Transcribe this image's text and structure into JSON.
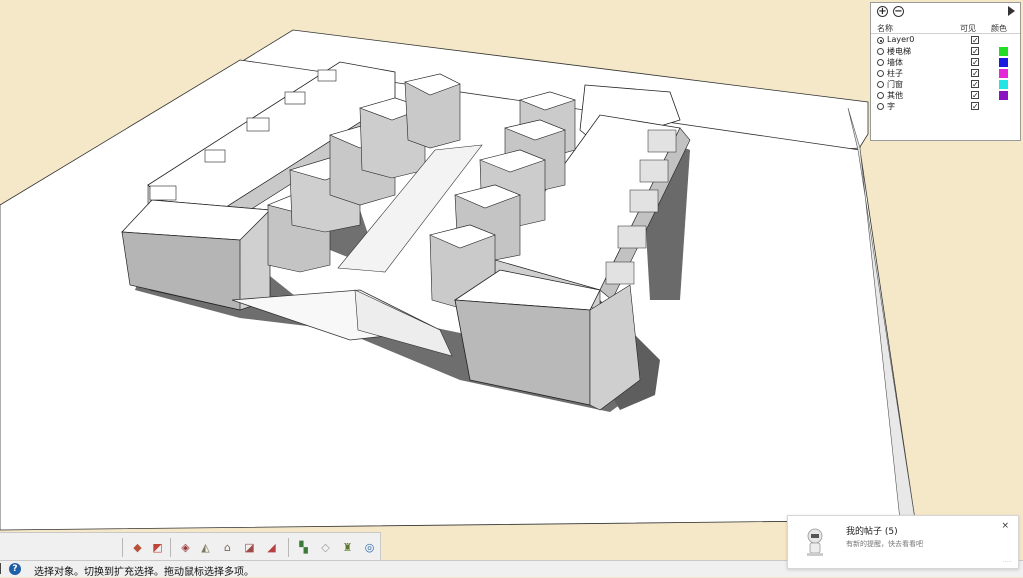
{
  "layers_panel": {
    "add_icon": "plus-circle-icon",
    "remove_icon": "minus-circle-icon",
    "details_icon": "details-arrow-icon",
    "col_name": "名称",
    "col_visible": "可见",
    "col_color": "颜色",
    "visible_mark": "✓",
    "layers": [
      {
        "name": "Layer0",
        "active": true,
        "visible": true,
        "color": ""
      },
      {
        "name": "楼电梯",
        "active": false,
        "visible": true,
        "color": "#22dd22"
      },
      {
        "name": "墙体",
        "active": false,
        "visible": true,
        "color": "#1c1ce0"
      },
      {
        "name": "柱子",
        "active": false,
        "visible": true,
        "color": "#e428d8"
      },
      {
        "name": "门窗",
        "active": false,
        "visible": true,
        "color": "#22e4e4"
      },
      {
        "name": "其他",
        "active": false,
        "visible": true,
        "color": "#8a14c0"
      },
      {
        "name": "字",
        "active": false,
        "visible": true,
        "color": ""
      }
    ]
  },
  "toolbar": {
    "icons": [
      "view-iso-icon",
      "view-top-icon",
      "view-front-icon",
      "view-right-icon",
      "view-back-icon",
      "view-left-icon",
      "view-bottom-icon",
      "walk-icon",
      "look-around-icon",
      "position-camera-icon",
      "geo-location-icon"
    ]
  },
  "status_bar": {
    "help_icon": "help-icon",
    "help_glyph": "?",
    "message": "选择对象。切换到扩充选择。拖动鼠标选择多项。"
  },
  "notification": {
    "title": "我的帖子 (5)",
    "message": "有新的提醒，快去看看吧",
    "close": "×",
    "dots": "·····",
    "avatar_icon": "robot-avatar-icon"
  },
  "colors": {
    "sky": "#f5e8c8",
    "ground": "#ffffff",
    "shadow": "#6e6e6e",
    "wall": "#d8d8d8"
  }
}
